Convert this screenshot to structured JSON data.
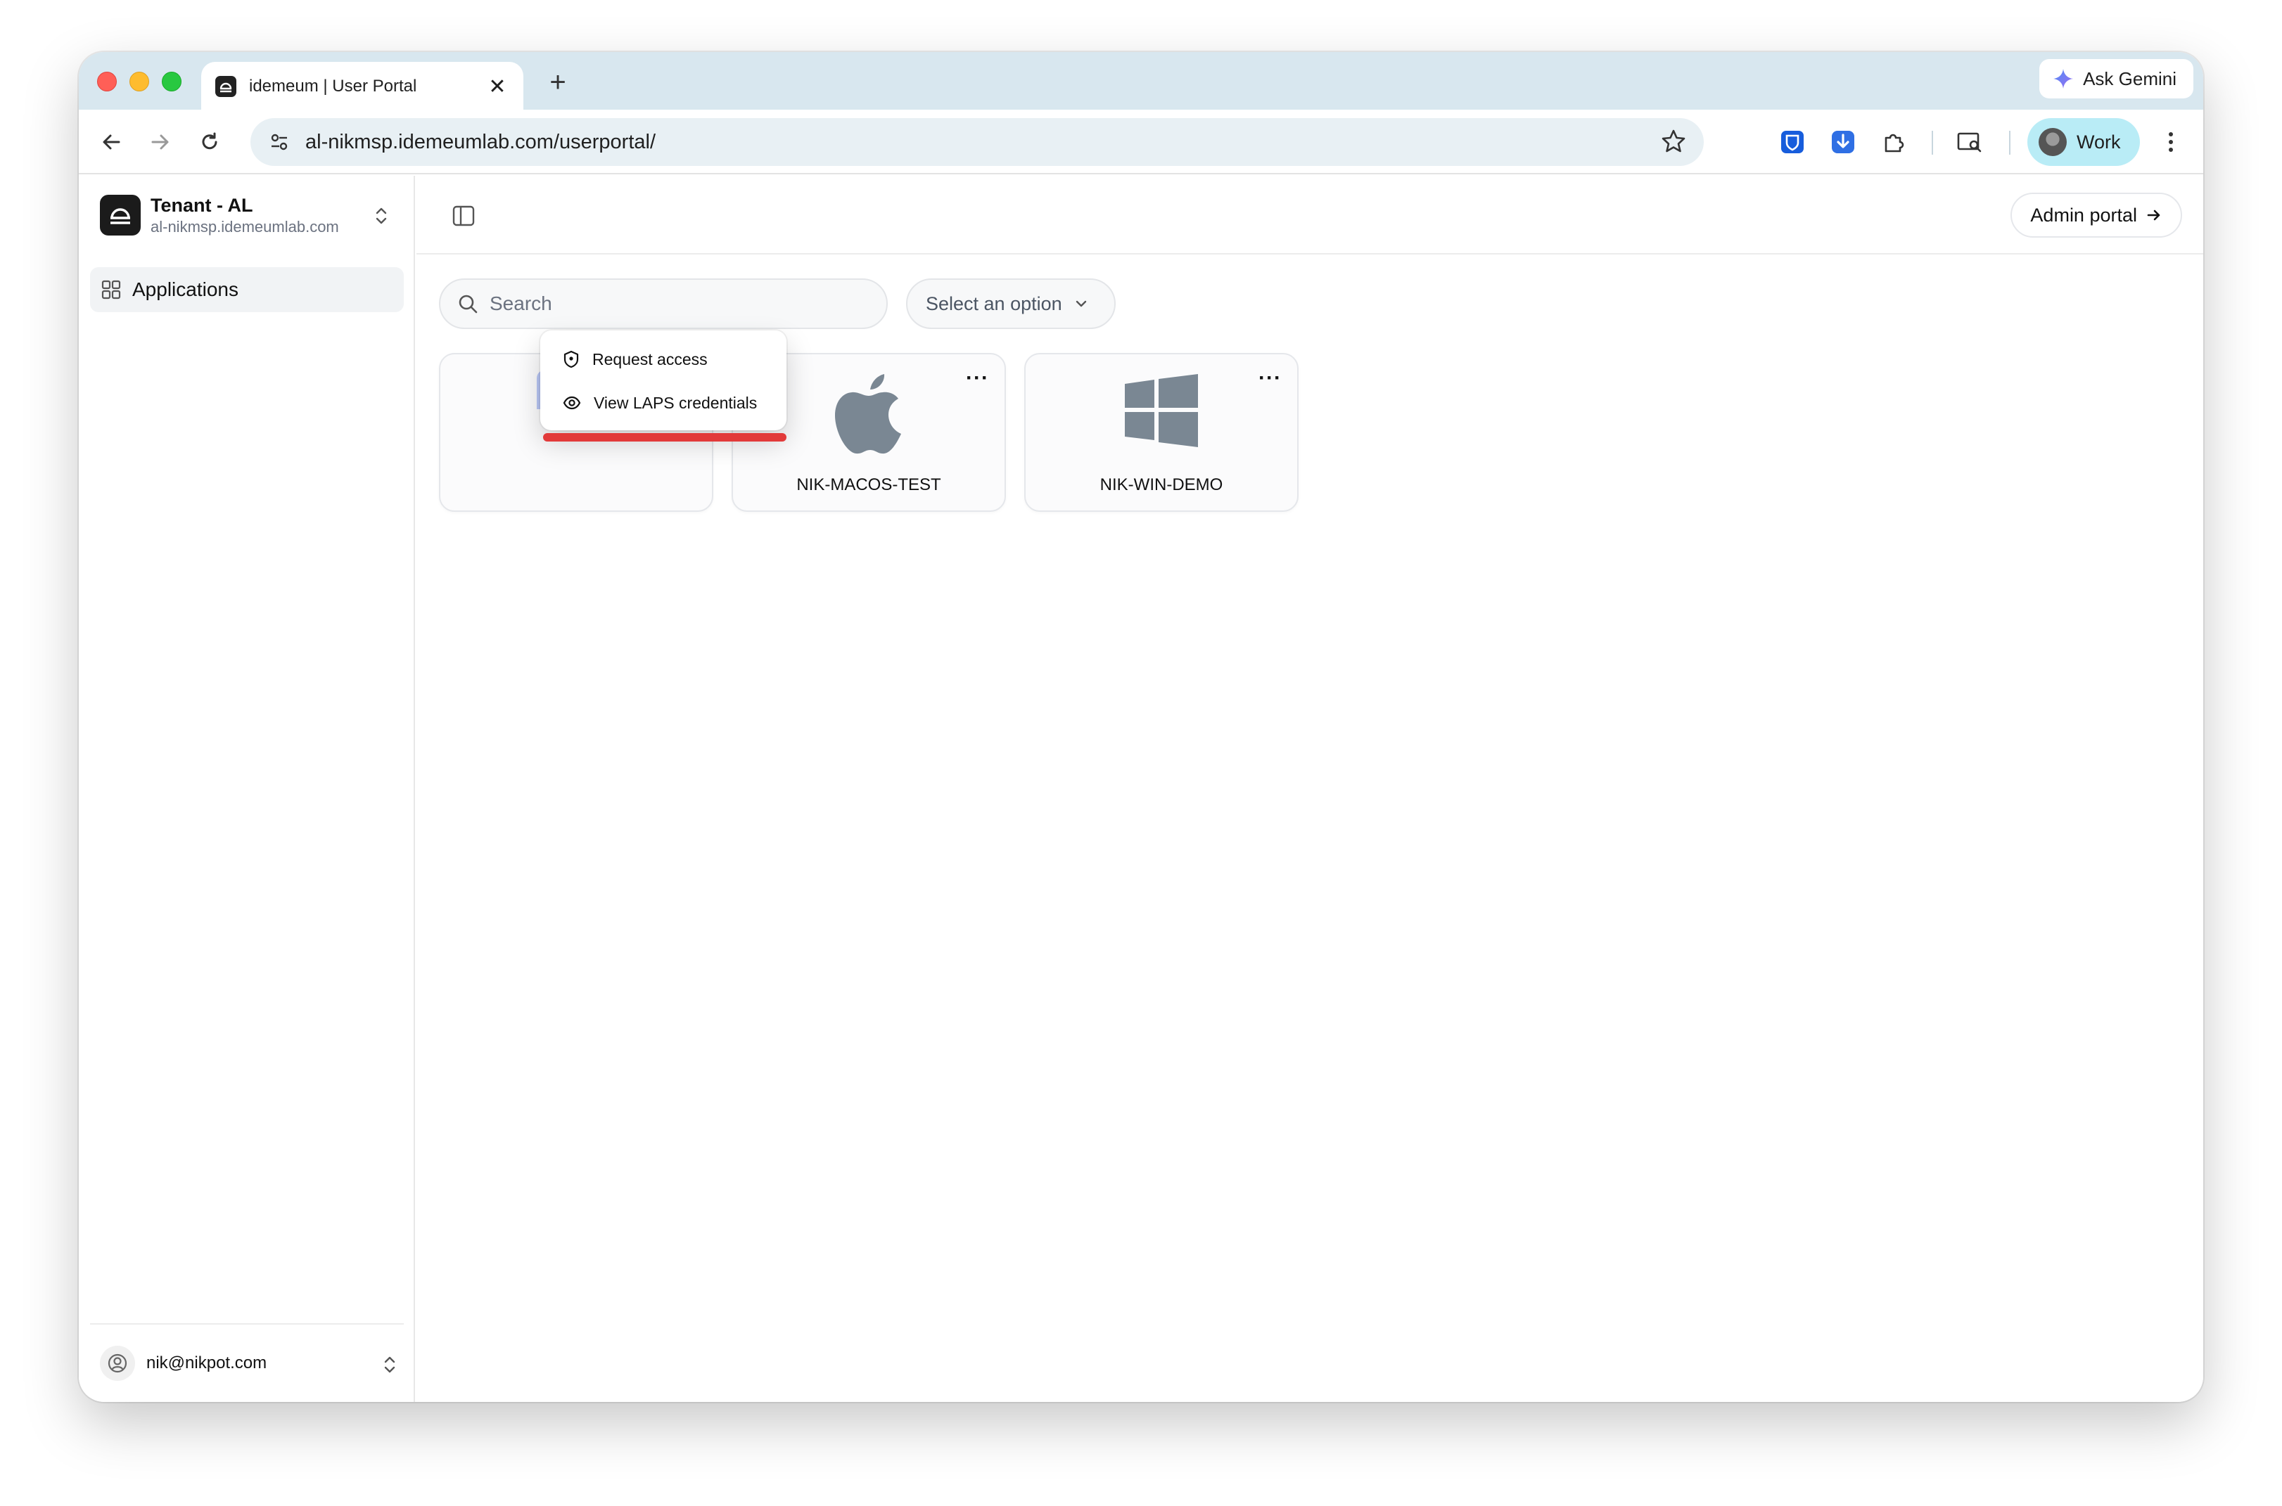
{
  "browser": {
    "tab_title": "idemeum | User Portal",
    "url": "al-nikmsp.idemeumlab.com/userportal/",
    "gemini_label": "Ask Gemini",
    "profile_label": "Work",
    "new_tab_symbol": "+",
    "close_symbol": "✕"
  },
  "sidebar": {
    "tenant_name": "Tenant - AL",
    "tenant_domain": "al-nikmsp.idemeumlab.com",
    "nav": [
      {
        "label": "Applications",
        "icon": "grid-icon",
        "active": true
      }
    ],
    "user_email": "nik@nikpot.com"
  },
  "header": {
    "admin_portal_label": "Admin portal"
  },
  "filters": {
    "search_placeholder": "Search",
    "select_label": "Select an option"
  },
  "apps": [
    {
      "name": "",
      "icon": "app-icon"
    },
    {
      "name": "NIK-MACOS-TEST",
      "icon": "apple-icon"
    },
    {
      "name": "NIK-WIN-DEMO",
      "icon": "windows-icon"
    }
  ],
  "context_menu": {
    "items": [
      {
        "label": "Request access",
        "icon": "shield-icon"
      },
      {
        "label": "View LAPS credentials",
        "icon": "eye-icon"
      }
    ]
  },
  "colors": {
    "highlight": "#e23a3a",
    "titlebar": "#d8e7ef",
    "profile_chip": "#b9ecf6",
    "app_icon_gray": "#7a8793"
  }
}
